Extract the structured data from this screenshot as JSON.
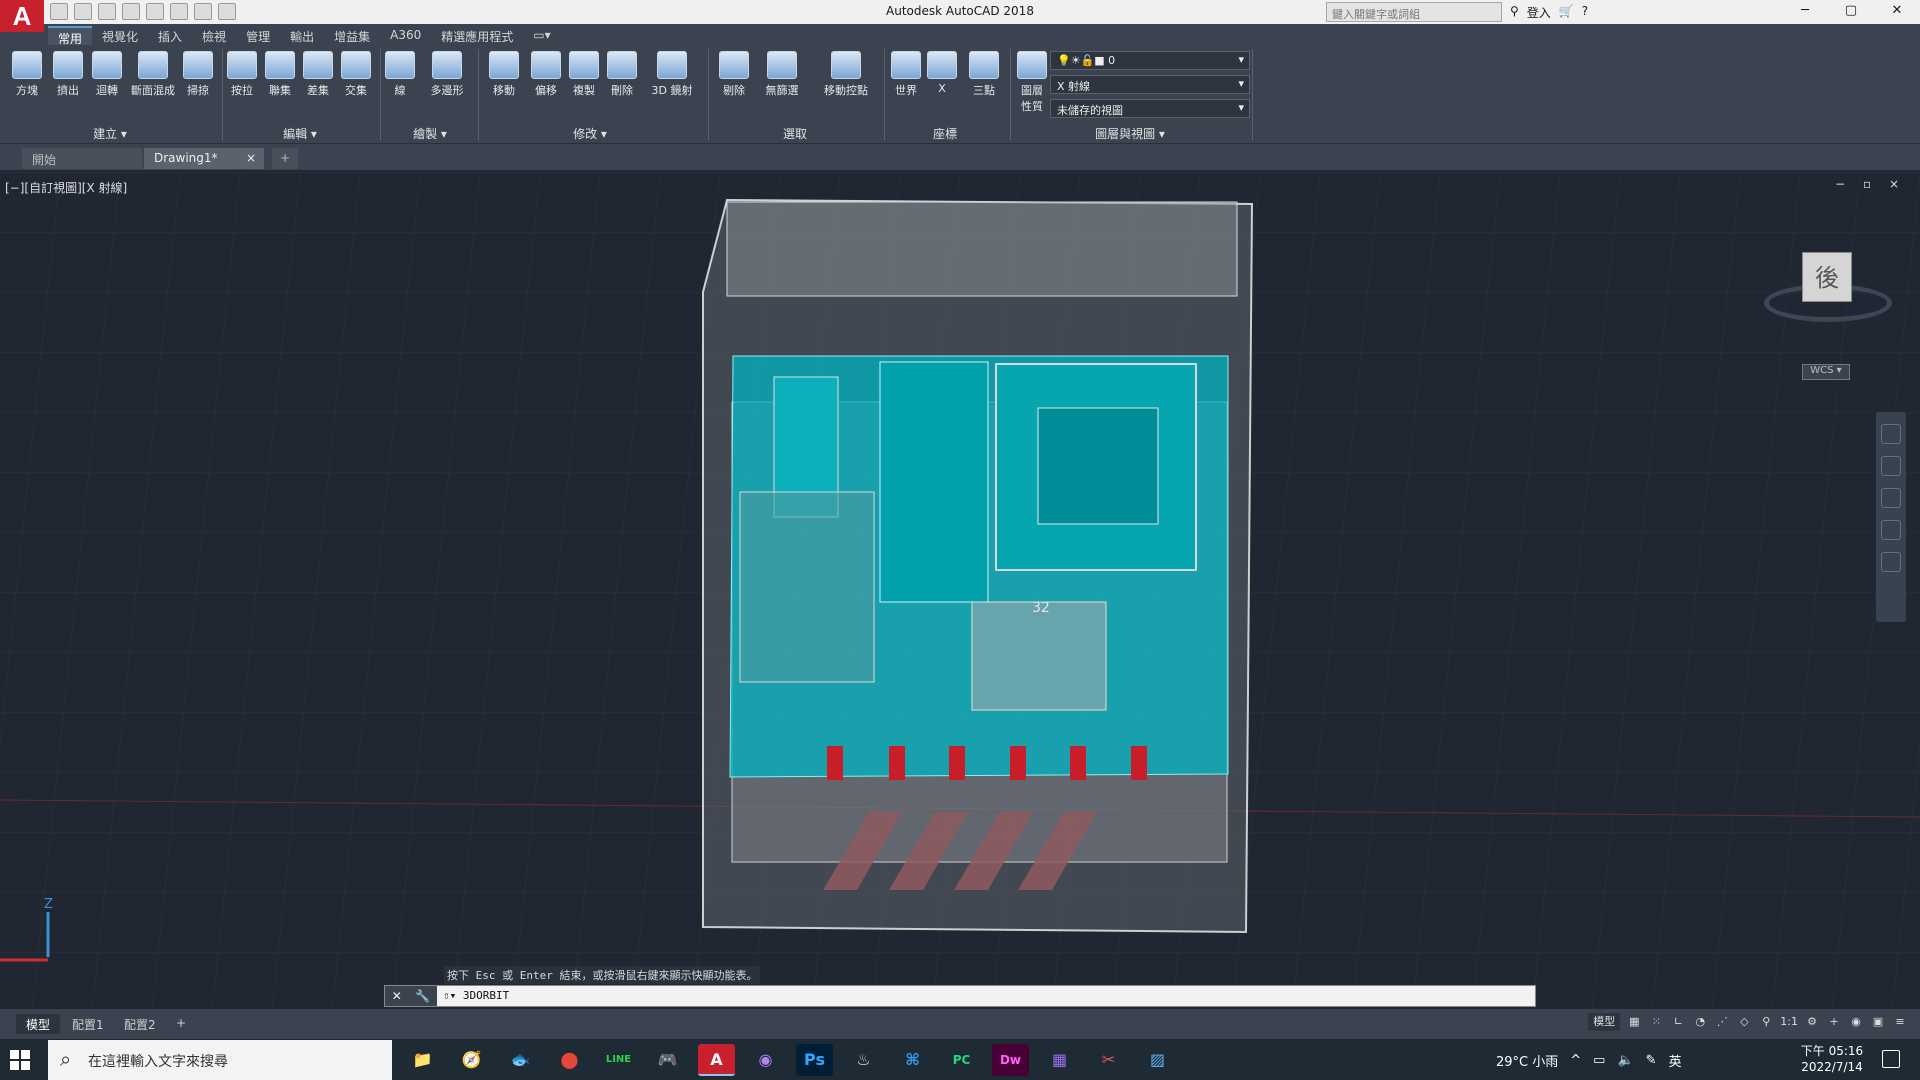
{
  "app": {
    "logo": "A",
    "title": "Autodesk AutoCAD 2018",
    "search_placeholder": "鍵入關鍵字或詞組",
    "login": "登入",
    "win_min": "─",
    "win_max": "▢",
    "win_close": "✕"
  },
  "ribbon_tabs": [
    "常用",
    "視覺化",
    "插入",
    "檢視",
    "管理",
    "輸出",
    "增益集",
    "A360",
    "精選應用程式",
    "▭▾"
  ],
  "tools": {
    "box": "方塊",
    "extrude": "擠出",
    "revolve": "迴轉",
    "loft": "斷面混成",
    "sweep": "掃掠",
    "presspull": "按拉",
    "union": "聯集",
    "subtract": "差集",
    "intersect": "交集",
    "line": "線",
    "polygon": "多邊形",
    "move": "移動",
    "offset": "偏移",
    "copy": "複製",
    "erase": "刪除",
    "array3d": "3D 鏡射",
    "culling": "剔除",
    "nofilter": "無篩選",
    "gizmo": "移動控點",
    "world": "世界",
    "x": "X",
    "three_point": "三點",
    "layer_props": "圖層\n性質"
  },
  "panels": {
    "create": "建立 ▾",
    "edit": "編輯 ▾",
    "draw": "繪製 ▾",
    "modify": "修改 ▾",
    "select": "選取",
    "coordinates": "座標",
    "layers_views": "圖層與視圖 ▾"
  },
  "layer": {
    "current": "0",
    "visual_style": "X 射線",
    "view": "未儲存的視圖"
  },
  "doc_tabs": {
    "start": "開始",
    "drawing": "Drawing1*",
    "close": "×",
    "add": "+"
  },
  "viewport": {
    "label": "[−][自訂視圖][X 射線]",
    "controls": "− ▫ ×",
    "cube_face": "後",
    "wcs": "WCS ▾",
    "part_number": "32",
    "axis_z": "Z"
  },
  "command": {
    "tooltip": "按下 Esc 或 Enter 結束，或按滑鼠右鍵來顯示快顯功能表。",
    "prompt": "⇧▾ 3DORBIT",
    "btn_close": "✕",
    "btn_settings": "🔧"
  },
  "layout_tabs": [
    "模型",
    "配置1",
    "配置2",
    "+"
  ],
  "status": {
    "model": "模型",
    "scale": "1:1"
  },
  "taskbar": {
    "search": "在這裡輸入文字來搜尋",
    "weather": "29°C 小雨",
    "ime": "英",
    "time": "下午 05:16",
    "date": "2022/7/14",
    "apps": [
      "📁",
      "🧭",
      "🐟",
      "⬤",
      "LINE",
      "🎮",
      "A",
      "◉",
      "Ps",
      "♨",
      "⌘",
      "PC",
      "Dw",
      "▦",
      "✂",
      "▨"
    ]
  },
  "colors": {
    "accent": "#c8202c",
    "cyan": "#00b4c0",
    "red": "#c81e2a",
    "bg": "#202733"
  }
}
